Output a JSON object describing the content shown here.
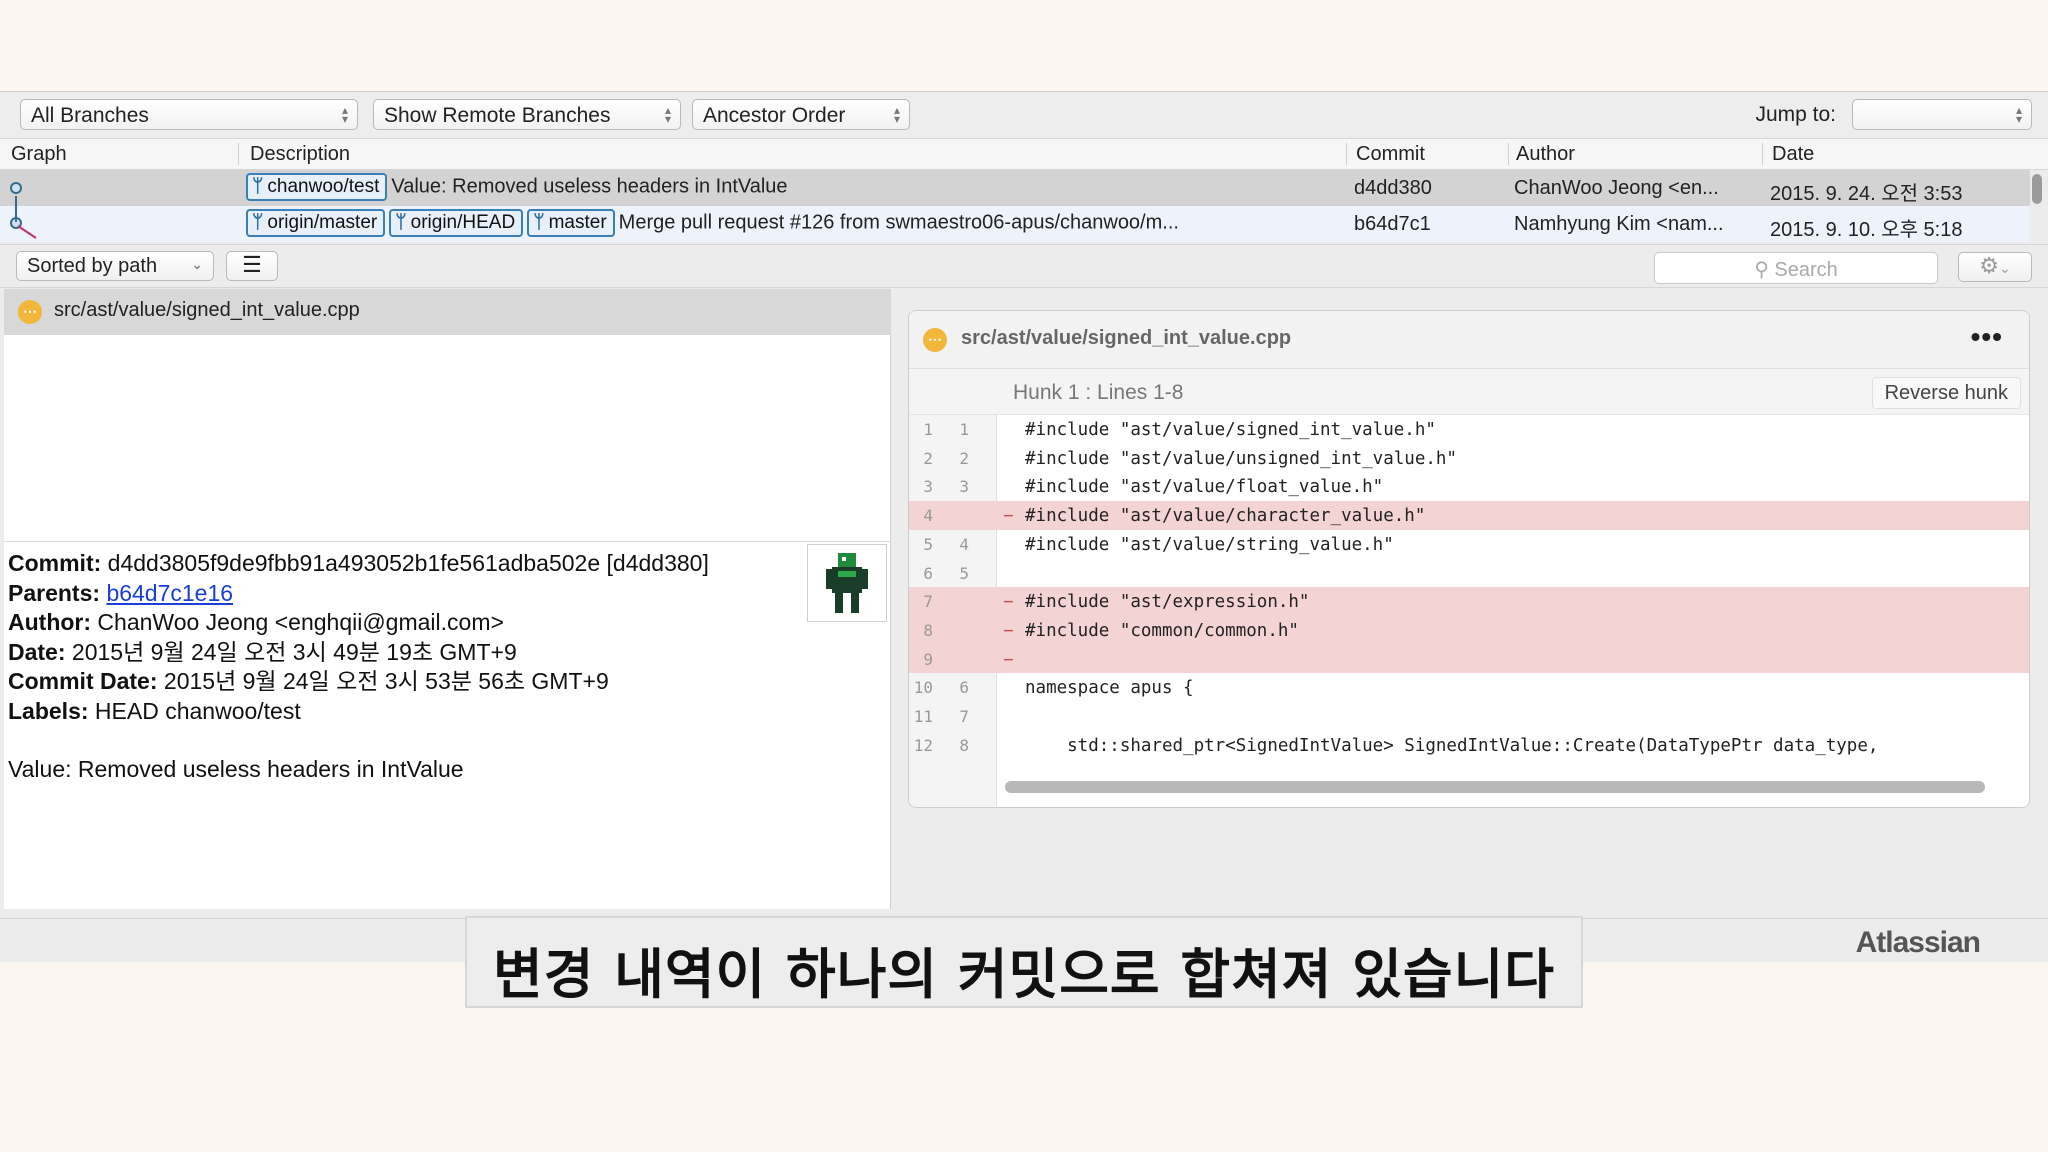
{
  "toolbar": {
    "branches": "All Branches",
    "remote": "Show Remote Branches",
    "order": "Ancestor Order",
    "jump_label": "Jump to:"
  },
  "table": {
    "headers": [
      "Graph",
      "Description",
      "Commit",
      "Author",
      "Date"
    ],
    "rows": [
      {
        "tags": [
          "chanwoo/test"
        ],
        "description": "Value: Removed useless headers in IntValue",
        "commit": "d4dd380",
        "author": "ChanWoo Jeong <en...",
        "date": "2015. 9. 24. 오전 3:53"
      },
      {
        "tags": [
          "origin/master",
          "origin/HEAD",
          "master"
        ],
        "description": "Merge pull request #126 from swmaestro06-apus/chanwoo/m...",
        "commit": "b64d7c1",
        "author": "Namhyung Kim <nam...",
        "date": "2015. 9. 10. 오후 5:18"
      }
    ]
  },
  "files_bar": {
    "sort": "Sorted by path",
    "search_placeholder": "Search"
  },
  "file_list": {
    "path": "src/ast/value/signed_int_value.cpp"
  },
  "commit_info": {
    "commit_label": "Commit:",
    "commit_value": "d4dd3805f9de9fbb91a493052b1fe561adba502e [d4dd380]",
    "parents_label": "Parents:",
    "parents_value": "b64d7c1e16",
    "author_label": "Author:",
    "author_value": "ChanWoo Jeong <enghqii@gmail.com>",
    "date_label": "Date:",
    "date_value": "2015년 9월 24일 오전 3시 49분 19초 GMT+9",
    "commit_date_label": "Commit Date:",
    "commit_date_value": "2015년 9월 24일 오전 3시 53분 56초 GMT+9",
    "labels_label": "Labels:",
    "labels_value": "HEAD chanwoo/test",
    "message": "Value: Removed useless headers in IntValue"
  },
  "diff": {
    "file": "src/ast/value/signed_int_value.cpp",
    "menu": "•••",
    "hunk_title": "Hunk 1 : Lines 1-8",
    "reverse_label": "Reverse hunk",
    "lines": [
      {
        "old": "1",
        "new": "1",
        "type": "ctx",
        "code": "#include \"ast/value/signed_int_value.h\""
      },
      {
        "old": "2",
        "new": "2",
        "type": "ctx",
        "code": "#include \"ast/value/unsigned_int_value.h\""
      },
      {
        "old": "3",
        "new": "3",
        "type": "ctx",
        "code": "#include \"ast/value/float_value.h\""
      },
      {
        "old": "4",
        "new": "",
        "type": "del",
        "code": "#include \"ast/value/character_value.h\""
      },
      {
        "old": "5",
        "new": "4",
        "type": "ctx",
        "code": "#include \"ast/value/string_value.h\""
      },
      {
        "old": "6",
        "new": "5",
        "type": "ctx",
        "code": ""
      },
      {
        "old": "7",
        "new": "",
        "type": "del",
        "code": "#include \"ast/expression.h\""
      },
      {
        "old": "8",
        "new": "",
        "type": "del",
        "code": "#include \"common/common.h\""
      },
      {
        "old": "9",
        "new": "",
        "type": "del",
        "code": ""
      },
      {
        "old": "10",
        "new": "6",
        "type": "ctx",
        "code": "namespace apus {"
      },
      {
        "old": "11",
        "new": "7",
        "type": "ctx",
        "code": ""
      },
      {
        "old": "12",
        "new": "8",
        "type": "ctx",
        "code": "    std::shared_ptr<SignedIntValue> SignedIntValue::Create(DataTypePtr data_type,"
      }
    ]
  },
  "watermark": "Atlassian",
  "subtitle": "변경 내역이 하나의 커밋으로 합쳐져 있습니다",
  "colors": {
    "tag_border": "#3b7fb8",
    "deleted_line": "#f4d3d5",
    "modified_icon": "#f2b63b",
    "link": "#1a3fd6"
  }
}
